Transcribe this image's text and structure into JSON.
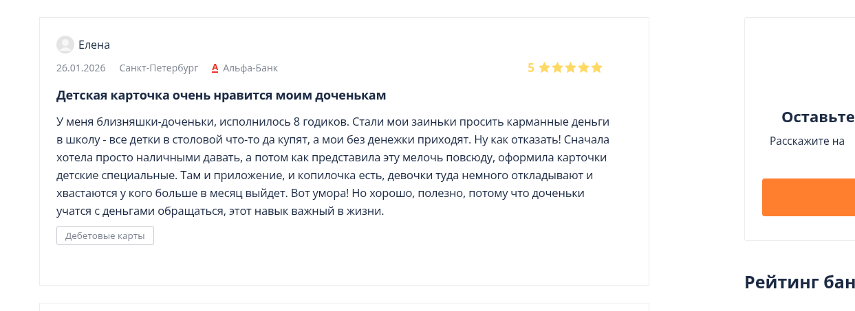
{
  "review": {
    "author": "Елена",
    "date": "26.01.2026",
    "city": "Санкт-Петербург",
    "bank_logo": "А",
    "bank": "Альфа-Банк",
    "rating": "5",
    "stars": 5,
    "title": "Детская карточка очень нравится моим доченькам",
    "text": "У меня близняшки-доченьки, исполнилось 8 годиков. Стали мои заиньки просить карманные деньги в школу - все детки в столовой что-то да купят, а мои без денежки приходят. Ну как отказать! Сначала хотела просто наличными давать, а потом как представила эту мелочь повсюду, оформила карточки детские специальные. Там и приложение, и копилочка есть, девочки туда немного откладывают и хвастаются у кого больше в месяц выйдет. Вот умора! Но хорошо, полезно, потому что доченьки учатся с деньгами обращаться, этот навык важный в жизни.",
    "tag": "Дебетовые карты"
  },
  "sidebar": {
    "cta_title": "Оставьте",
    "cta_text": "Расскажите на",
    "rating_heading": "Рейтинг бан"
  }
}
